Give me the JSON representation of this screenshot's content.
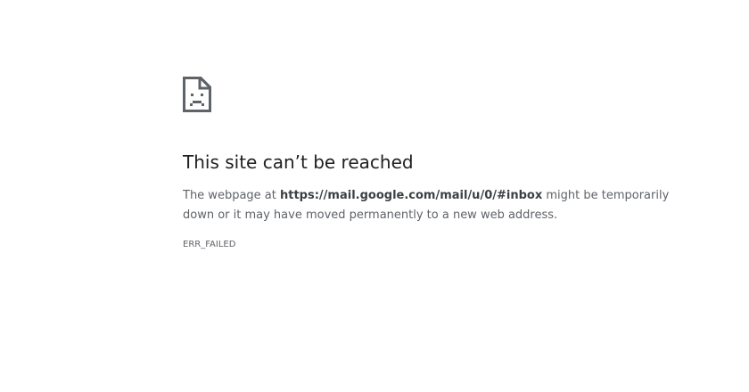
{
  "error_page": {
    "icon": "sad-page-icon",
    "title": "This site can’t be reached",
    "message_before_url": "The webpage at ",
    "url": "https://mail.google.com/mail/u/0/#inbox",
    "message_after_url": " might be temporarily down or it may have moved permanently to a new web address.",
    "error_code": "ERR_FAILED"
  },
  "colors": {
    "background": "#ffffff",
    "title": "#202124",
    "body_text": "#5f6368"
  }
}
